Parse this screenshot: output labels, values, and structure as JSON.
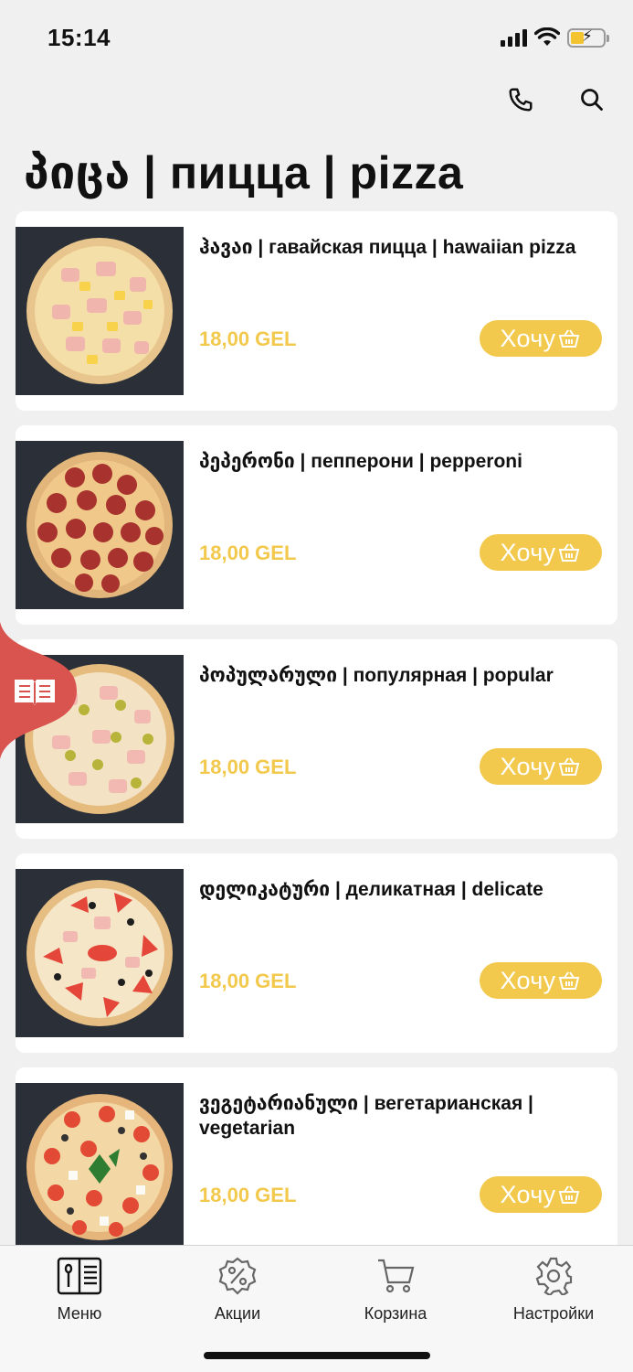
{
  "status_bar": {
    "time": "15:14"
  },
  "page": {
    "title": "პიცა | пицца | pizza"
  },
  "top_actions": {
    "call_icon": "phone-icon",
    "search_icon": "search-icon"
  },
  "products": [
    {
      "name": "ჰავაი | гавайская пицца | hawaiian pizza",
      "price": "18,00 GEL",
      "button": "Хочу",
      "image": "hawaiian"
    },
    {
      "name": "პეპერონი | пепперони | pepperoni",
      "price": "18,00 GEL",
      "button": "Хочу",
      "image": "pepperoni"
    },
    {
      "name": "პოპულარული | популярная | popular",
      "price": "18,00 GEL",
      "button": "Хочу",
      "image": "popular"
    },
    {
      "name": "დელიკატური | деликатная | delicate",
      "price": "18,00 GEL",
      "button": "Хочу",
      "image": "delicate"
    },
    {
      "name": "ვეგეტარიანული | вегетарианская | vegetarian",
      "price": "18,00 GEL",
      "button": "Хочу",
      "image": "vegetarian"
    }
  ],
  "tabbar": {
    "items": [
      {
        "label": "Меню",
        "icon": "menu-book-icon"
      },
      {
        "label": "Акции",
        "icon": "discount-badge-icon"
      },
      {
        "label": "Корзина",
        "icon": "cart-icon"
      },
      {
        "label": "Настройки",
        "icon": "gear-icon"
      }
    ]
  },
  "colors": {
    "accent": "#f2c94c",
    "side_tab": "#d9534f",
    "background": "#f0f0f0"
  }
}
